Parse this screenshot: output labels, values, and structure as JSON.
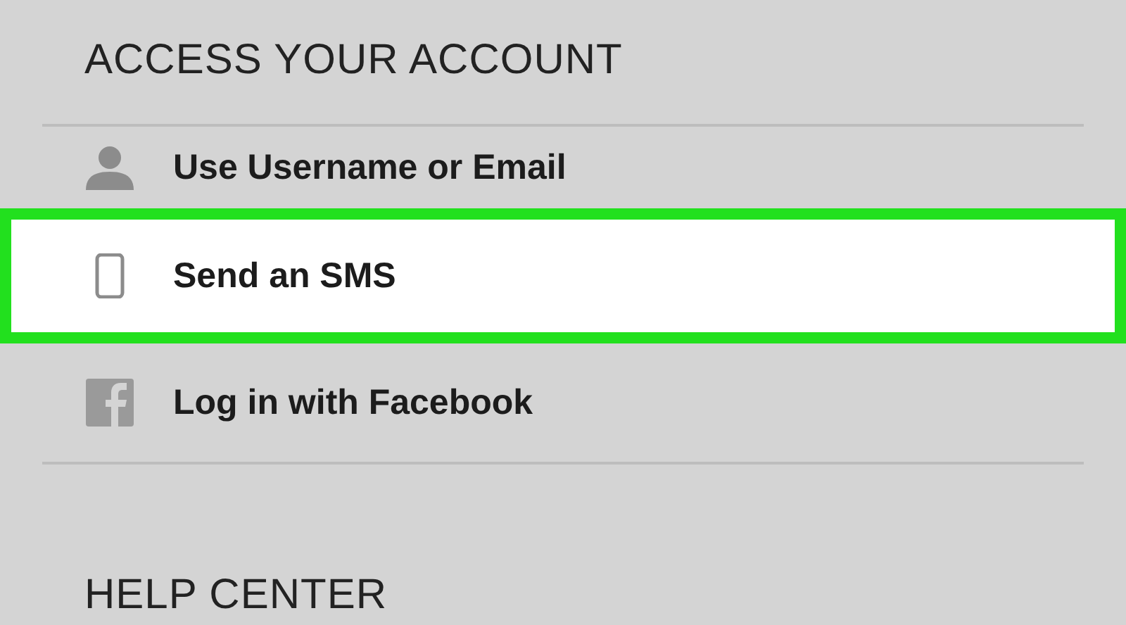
{
  "sections": [
    {
      "title": "ACCESS YOUR ACCOUNT",
      "items": [
        {
          "label": "Use Username or Email",
          "kind": "user",
          "selected": false
        },
        {
          "label": "Send an SMS",
          "kind": "phone",
          "selected": true
        },
        {
          "label": "Log in with Facebook",
          "kind": "facebook",
          "selected": false
        }
      ]
    },
    {
      "title": "HELP CENTER"
    }
  ]
}
